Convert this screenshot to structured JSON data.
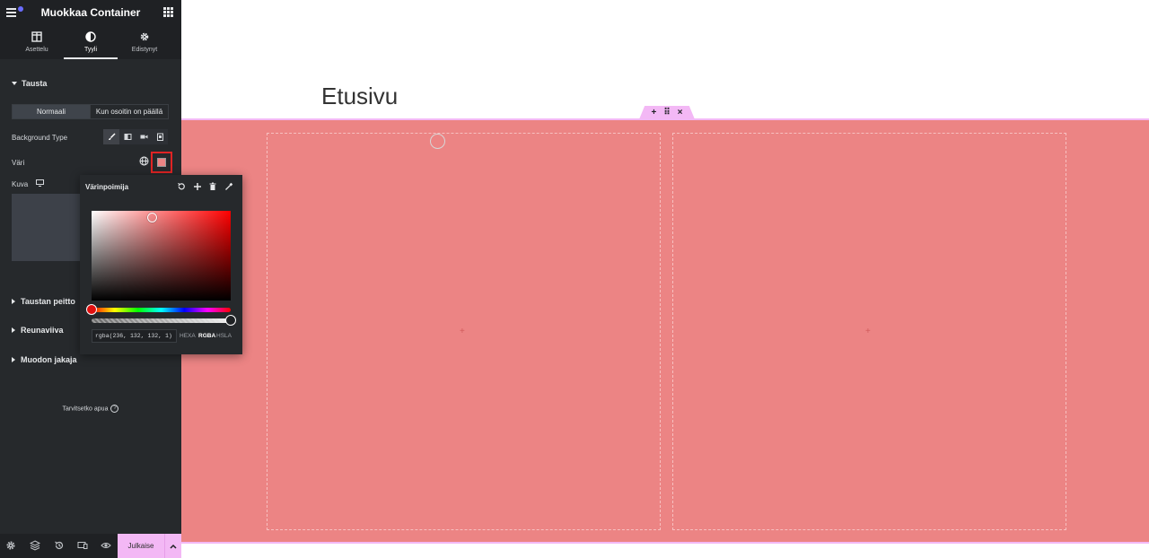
{
  "sidebar": {
    "title": "Muokkaa Container",
    "tabs": [
      {
        "label": "Asettelu",
        "icon": "layout-icon"
      },
      {
        "label": "Tyyli",
        "icon": "style-icon"
      },
      {
        "label": "Edistynyt",
        "icon": "gear-icon"
      }
    ],
    "active_tab": "Tyyli",
    "section_background": "Tausta",
    "state_toggle": {
      "normal": "Normaali",
      "hover": "Kun osoitin on päällä",
      "selected": "Normaali"
    },
    "background_type_label": "Background Type",
    "background_type_icons": [
      "brush-icon",
      "gradient-icon",
      "video-icon",
      "slideshow-icon"
    ],
    "color_label": "Väri",
    "image_label": "Kuva",
    "collapsed_sections": [
      "Taustan peitto",
      "Reunaviiva",
      "Muodon jakaja"
    ],
    "help_text": "Tarvitsetko apua",
    "footer": {
      "publish_label": "Julkaise"
    }
  },
  "canvas": {
    "page_title": "Etusivu",
    "container_color": "#ec8484"
  },
  "color_picker": {
    "title": "Värinpoimija",
    "value": "rgba(236, 132, 132, 1)",
    "modes": [
      "HEXA",
      "RGBA",
      "HSLA"
    ],
    "active_mode": "RGBA"
  },
  "colors": {
    "accent_pink": "#f3b8f5",
    "highlight_red": "#e02424",
    "sidebar_bg": "#26292c"
  }
}
